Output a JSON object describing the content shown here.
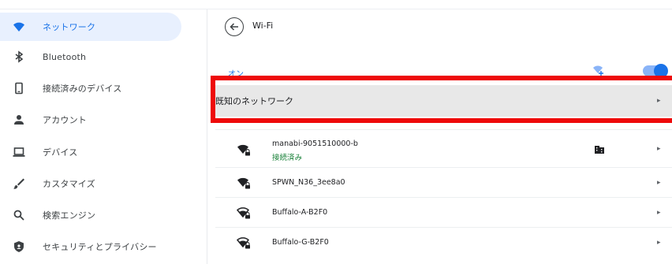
{
  "sidebar": {
    "items": [
      {
        "label": "ネットワーク",
        "icon": "wifi-icon",
        "active": true
      },
      {
        "label": "Bluetooth",
        "icon": "bluetooth-icon"
      },
      {
        "label": "接続済みのデバイス",
        "icon": "phone-icon"
      },
      {
        "label": "アカウント",
        "icon": "person-icon"
      },
      {
        "label": "デバイス",
        "icon": "laptop-icon"
      },
      {
        "label": "カスタマイズ",
        "icon": "brush-icon"
      },
      {
        "label": "検索エンジン",
        "icon": "search-icon"
      },
      {
        "label": "セキュリティとプライバシー",
        "icon": "shield-icon"
      }
    ]
  },
  "header": {
    "title": "Wi-Fi"
  },
  "wifi": {
    "state_label": "オン",
    "enabled": true,
    "known_networks_label": "既知のネットワーク"
  },
  "networks": [
    {
      "name": "manabi-9051510000-b",
      "status": "接続済み"
    },
    {
      "name": "SPWN_N36_3ee8a0"
    },
    {
      "name": "Buffalo-A-B2F0"
    },
    {
      "name": "Buffalo-G-B2F0"
    }
  ],
  "colors": {
    "accent": "#1a73e8",
    "highlight": "#ee0a0a",
    "connected": "#188038"
  }
}
